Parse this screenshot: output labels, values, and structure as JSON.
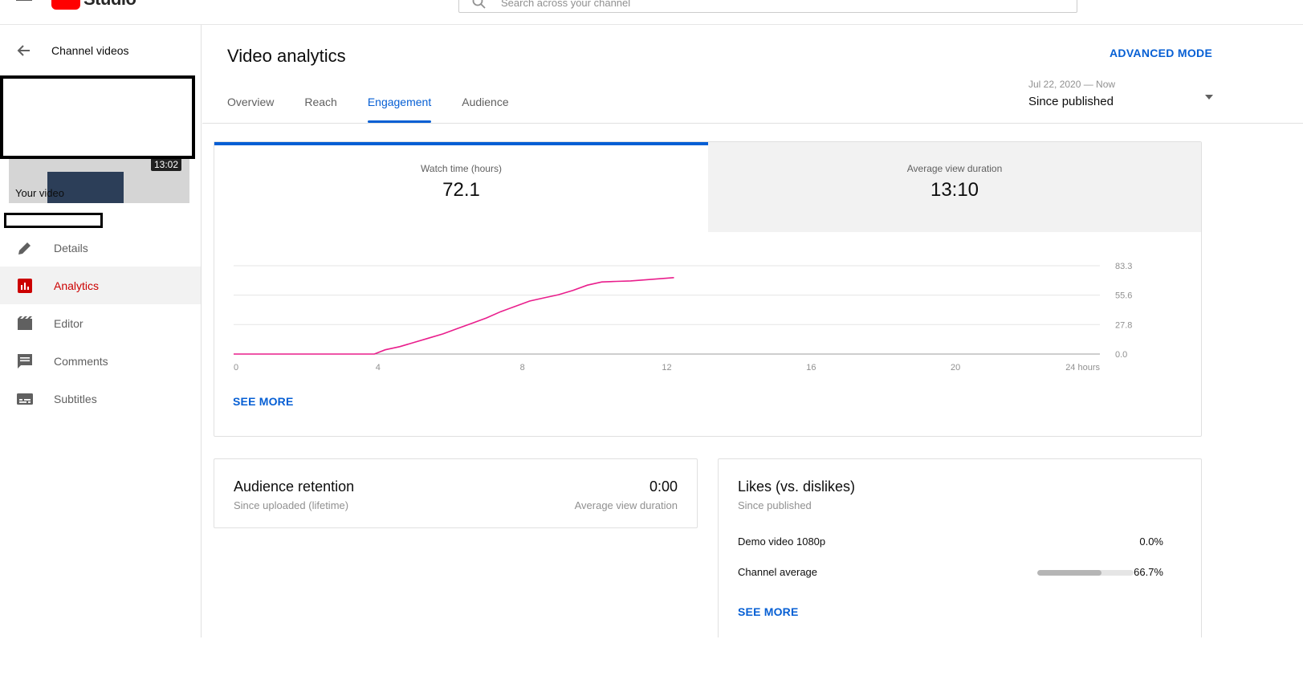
{
  "topbar": {
    "logo_text": "Studio",
    "search_placeholder": "Search across your channel"
  },
  "sidebar": {
    "back_label": "Channel videos",
    "thumbnail_duration": "13:02",
    "your_video_label": "Your video",
    "items": [
      {
        "label": "Details",
        "icon": "pencil-icon",
        "active": false
      },
      {
        "label": "Analytics",
        "icon": "analytics-icon",
        "active": true
      },
      {
        "label": "Editor",
        "icon": "editor-icon",
        "active": false
      },
      {
        "label": "Comments",
        "icon": "comments-icon",
        "active": false
      },
      {
        "label": "Subtitles",
        "icon": "subtitles-icon",
        "active": false
      }
    ]
  },
  "main": {
    "title": "Video analytics",
    "advanced_mode": "ADVANCED MODE",
    "tabs": [
      {
        "label": "Overview",
        "active": false
      },
      {
        "label": "Reach",
        "active": false
      },
      {
        "label": "Engagement",
        "active": true
      },
      {
        "label": "Audience",
        "active": false
      }
    ],
    "date_range": {
      "dates": "Jul 22, 2020 — Now",
      "value": "Since published"
    }
  },
  "engagement": {
    "metrics": [
      {
        "label": "Watch time (hours)",
        "value": "72.1",
        "selected": true
      },
      {
        "label": "Average view duration",
        "value": "13:10",
        "selected": false
      }
    ],
    "see_more": "SEE MORE"
  },
  "chart_data": {
    "type": "line",
    "x_ticks": [
      "0",
      "4",
      "8",
      "12",
      "16",
      "20",
      "24 hours"
    ],
    "y_ticks": [
      "83.3",
      "55.6",
      "27.8",
      "0.0"
    ],
    "xlim": [
      0,
      24
    ],
    "ylim": [
      0,
      83.3
    ],
    "grid": true,
    "series": [
      {
        "color": "#e91e8c",
        "x": [
          0,
          3.9,
          4.2,
          4.6,
          5.0,
          5.4,
          5.8,
          6.2,
          6.6,
          7.0,
          7.4,
          7.8,
          8.2,
          8.6,
          9.0,
          9.4,
          9.8,
          10.2,
          10.6,
          11.0,
          11.4,
          11.8,
          12.2
        ],
        "y": [
          0,
          0,
          4,
          7,
          11,
          15,
          19,
          24,
          29,
          34,
          40,
          45,
          50,
          53,
          56,
          60,
          65,
          68,
          68.5,
          69,
          70,
          71,
          72.1
        ]
      }
    ]
  },
  "retention": {
    "title": "Audience retention",
    "subtitle": "Since uploaded (lifetime)",
    "value": "0:00",
    "value_label": "Average view duration"
  },
  "likes": {
    "title": "Likes (vs. dislikes)",
    "subtitle": "Since published",
    "rows": [
      {
        "label": "Demo video 1080p",
        "value": "0.0%",
        "fraction": 0.0,
        "show_bar": false
      },
      {
        "label": "Channel average",
        "value": "66.7%",
        "fraction": 0.667,
        "show_bar": true
      }
    ],
    "see_more": "SEE MORE"
  },
  "colors": {
    "accent": "#065fd4",
    "active_nav": "#cc0000",
    "chart_line": "#e91e8c"
  }
}
